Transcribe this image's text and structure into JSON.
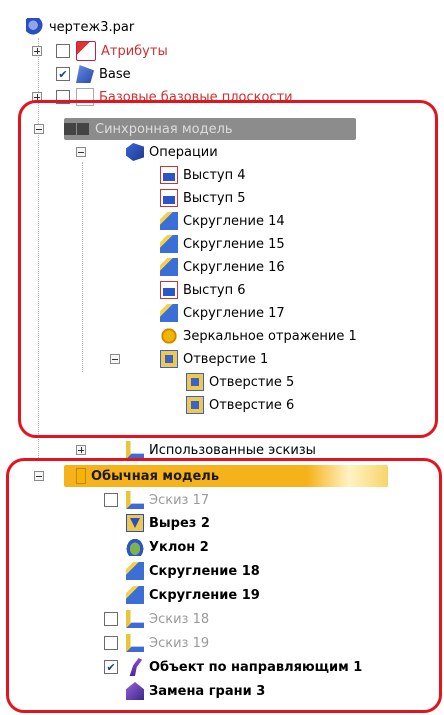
{
  "tree": {
    "root": {
      "label": "чертеж3.par",
      "icon": "part-icon"
    },
    "attributes": {
      "label": "Атрибуты",
      "icon": "attributes-icon"
    },
    "base": {
      "label": "Base",
      "icon": "base-icon"
    },
    "base_refs": {
      "label": "Базовые базовые плоскости",
      "icon": "reference-planes-icon"
    },
    "sync_model": {
      "label": "Синхронная модель",
      "icon": "sync-model-icon"
    },
    "operations": {
      "label": "Операции",
      "icon": "operations-icon"
    },
    "ops": [
      {
        "label": "Выступ 4",
        "icon": "extrude-icon"
      },
      {
        "label": "Выступ 5",
        "icon": "extrude-icon"
      },
      {
        "label": "Скругление 14",
        "icon": "round-icon"
      },
      {
        "label": "Скругление 15",
        "icon": "round-icon"
      },
      {
        "label": "Скругление 16",
        "icon": "round-icon"
      },
      {
        "label": "Выступ 6",
        "icon": "extrude-icon"
      },
      {
        "label": "Скругление 17",
        "icon": "round-icon"
      },
      {
        "label": "Зеркальное отражение 1",
        "icon": "mirror-icon"
      }
    ],
    "holes": {
      "label": "Отверстие 1",
      "icon": "hole-icon"
    },
    "holes_children": [
      {
        "label": "Отверстие 5",
        "icon": "hole-icon"
      },
      {
        "label": "Отверстие 6",
        "icon": "hole-icon"
      }
    ],
    "used_sketches": {
      "label": "Использованные эскизы",
      "icon": "sketch-icon"
    },
    "ordered_model": {
      "label": "Обычная модель",
      "icon": "ordered-model-icon"
    },
    "ordered_items": [
      {
        "label": "Эскиз 17",
        "icon": "sketch-icon",
        "checkbox": true,
        "checked": false,
        "style": "gray"
      },
      {
        "label": "Вырез 2",
        "icon": "cut-icon",
        "checkbox": false,
        "style": "bold"
      },
      {
        "label": "Уклон 2",
        "icon": "draft-icon",
        "checkbox": false,
        "style": "bold"
      },
      {
        "label": "Скругление 18",
        "icon": "round-icon",
        "checkbox": false,
        "style": "bold"
      },
      {
        "label": "Скругление 19",
        "icon": "round-icon",
        "checkbox": false,
        "style": "bold"
      },
      {
        "label": "Эскиз 18",
        "icon": "sketch-icon",
        "checkbox": true,
        "checked": false,
        "style": "gray"
      },
      {
        "label": "Эскиз 19",
        "icon": "sketch-icon",
        "checkbox": true,
        "checked": false,
        "style": "gray"
      },
      {
        "label": "Объект по направляющим 1",
        "icon": "sweep-icon",
        "checkbox": true,
        "checked": true,
        "style": "bold"
      },
      {
        "label": "Замена грани 3",
        "icon": "replace-face-icon",
        "checkbox": false,
        "style": "bold"
      }
    ]
  },
  "colors": {
    "highlight_box": "#e4131d",
    "sync_band": "#8c8c8c",
    "ordered_band": "#f5b21a"
  }
}
